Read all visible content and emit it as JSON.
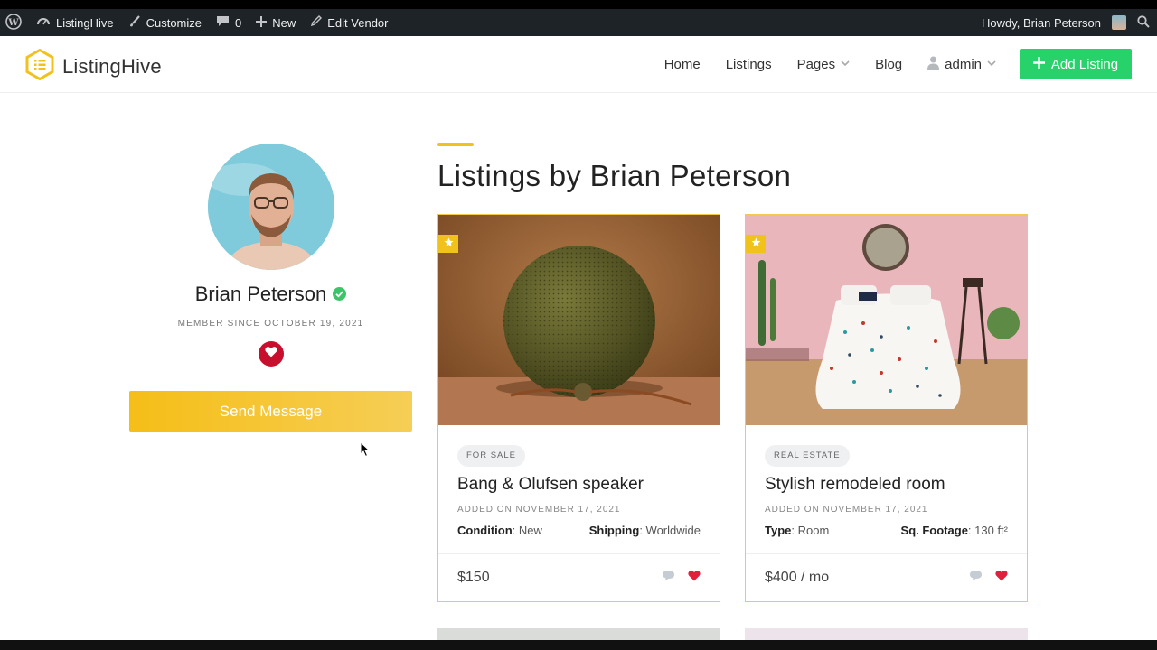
{
  "admin_bar": {
    "site_name": "ListingHive",
    "customize": "Customize",
    "comments_count": "0",
    "new": "New",
    "edit_vendor": "Edit Vendor",
    "howdy": "Howdy, Brian Peterson"
  },
  "header": {
    "logo_text": "ListingHive",
    "nav": [
      "Home",
      "Listings",
      "Pages",
      "Blog",
      "admin"
    ],
    "add_listing": "Add Listing"
  },
  "profile": {
    "name": "Brian Peterson",
    "member_since": "MEMBER SINCE OCTOBER 19, 2021",
    "send_message": "Send Message"
  },
  "section": {
    "title": "Listings by Brian Peterson"
  },
  "listings": [
    {
      "tag": "FOR SALE",
      "title": "Bang & Olufsen speaker",
      "added": "ADDED ON NOVEMBER 17, 2021",
      "attr1_label": "Condition",
      "attr1_value": ": New",
      "attr2_label": "Shipping",
      "attr2_value": ": Worldwide",
      "price": "$150"
    },
    {
      "tag": "REAL ESTATE",
      "title": "Stylish remodeled room",
      "added": "ADDED ON NOVEMBER 17, 2021",
      "attr1_label": "Type",
      "attr1_value": ": Room",
      "attr2_label": "Sq. Footage",
      "attr2_value": ": 130 ft²",
      "price": "$400 / mo"
    }
  ],
  "colors": {
    "admin_bar": "#1d2327",
    "brand_yellow": "#f2c21c",
    "add_listing_green": "#28d26a",
    "favorite_red": "#c8102e",
    "verified_green": "#3cc46a"
  },
  "icons": [
    "wordpress-icon",
    "dashboard-icon",
    "brush-icon",
    "comment-icon",
    "plus-icon",
    "pencil-icon",
    "search-icon",
    "user-icon",
    "verified-icon",
    "heart-icon",
    "star-icon",
    "cursor-icon"
  ]
}
